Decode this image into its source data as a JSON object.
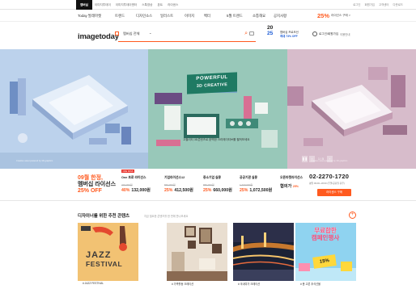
{
  "topbar": {
    "tabs": [
      "멤버십",
      "이미지투데이",
      "이미지투데이엔터",
      "스톡영상",
      "폰트",
      "라이센스"
    ],
    "util": [
      "로그인",
      "회원가입",
      "고객센터",
      "다운로드"
    ]
  },
  "menu": {
    "items": [
      "Today 발레마켓",
      "트렌드",
      "디자인소스",
      "일러스트",
      "이미지",
      "벡터",
      "5월 트렌드",
      "소통해요",
      "공지사항",
      "할인"
    ],
    "promo_pct": "25%",
    "promo_text": "라이선스 구매 >"
  },
  "header": {
    "logo": "imagetoday",
    "search_select": "멤버십 전체",
    "year_line1": "20",
    "year_line2": "25",
    "year_caption1": "멤버십 프로모션",
    "year_caption2": "최대 73% OFF",
    "login": "로그인/회원가입",
    "join": "이용안내"
  },
  "hero": {
    "badge_line1": "POWERFUL",
    "badge_line2": "3D CREATIVE",
    "caption": "고퀄리티 3D콘텐츠로 완벽한 크리에이티브를 펼쳐보세요",
    "note_left": "Creative asset powered by 3D graphics",
    "note_right": "Creative asset powered by 3D graphics",
    "pager_label": "1 / 5"
  },
  "prices": {
    "first_line1": "09월 한정,",
    "first_line2": "멤버십 라이선스",
    "first_line3": "25% OFF",
    "one_tag": "ONE PASS",
    "cols": [
      {
        "title": "One 프로 라이선스",
        "old": "220,000원",
        "pct": "40%",
        "price": "132,000원"
      },
      {
        "title": "기업라이선스12",
        "old": "550,000원",
        "pct": "25%",
        "price": "412,500원"
      },
      {
        "title": "중소기업 실몽",
        "old": "880,000원",
        "pct": "25%",
        "price": "660,000원"
      },
      {
        "title": "공공기관 실몽",
        "old": "1,430,000원",
        "pct": "25%",
        "price": "1,072,500원"
      },
      {
        "title": "오픈마켓라이선스",
        "old": "",
        "pct": "",
        "price": "협의가",
        "sub": "25%"
      }
    ],
    "phone": "02-2270-1720",
    "phone_sub": "평일 09:00~18:00 (주말/공휴일 휴무)",
    "buy_label": "라이센스 구매"
  },
  "recommend": {
    "title": "디자이너를 위한 추천 콘텐츠",
    "subtitle": "지금 필요한 콘텐츠를 한 번에 만나보세요",
    "cards": [
      {
        "caption": "# JAZZ FESTIVAL",
        "line1": "JAZZ",
        "line2": "FESTIVAL"
      },
      {
        "caption": "# 가족활동 크레이션"
      },
      {
        "caption": "# 국내여가 크레이션"
      },
      {
        "caption": "# 봄 고른 추석선물",
        "line1": "무료합한",
        "line2": "캠페인행사",
        "badge": "15%"
      }
    ]
  }
}
